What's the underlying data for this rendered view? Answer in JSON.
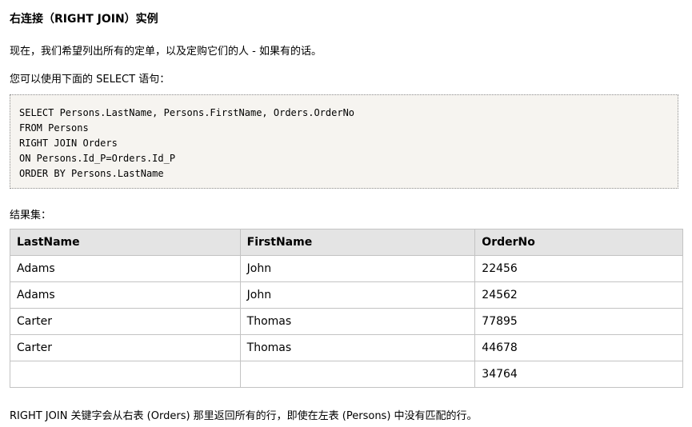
{
  "heading": "右连接（RIGHT JOIN）实例",
  "paragraphs": {
    "intro": "现在，我们希望列出所有的定单，以及定购它们的人 - 如果有的话。",
    "select_intro": "您可以使用下面的 SELECT 语句：",
    "result_label": "结果集：",
    "note": "RIGHT JOIN 关键字会从右表 (Orders) 那里返回所有的行，即使在左表 (Persons) 中没有匹配的行。"
  },
  "code": {
    "lines": [
      "SELECT Persons.LastName, Persons.FirstName, Orders.OrderNo",
      "FROM Persons",
      "RIGHT JOIN Orders",
      "ON Persons.Id_P=Orders.Id_P",
      "ORDER BY Persons.LastName"
    ]
  },
  "table": {
    "headers": [
      "LastName",
      "FirstName",
      "OrderNo"
    ],
    "rows": [
      [
        "Adams",
        "John",
        "22456"
      ],
      [
        "Adams",
        "John",
        "24562"
      ],
      [
        "Carter",
        "Thomas",
        "77895"
      ],
      [
        "Carter",
        "Thomas",
        "44678"
      ],
      [
        "",
        "",
        "34764"
      ]
    ]
  },
  "colors": {
    "code_background": "#f6f4f0",
    "code_border": "#8f8f8f",
    "table_header_background": "#e4e4e4",
    "table_border": "#c3c3c3"
  }
}
